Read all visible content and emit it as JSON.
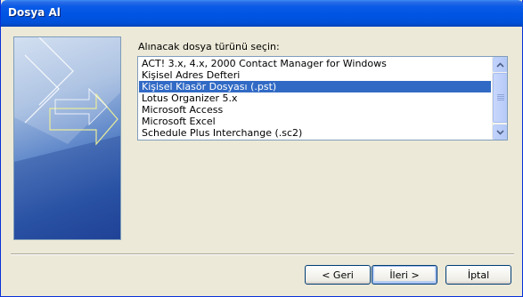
{
  "window": {
    "title": "Dosya Al"
  },
  "prompt": "Alınacak dosya türünü seçin:",
  "file_types": [
    "ACT! 3.x, 4.x, 2000 Contact Manager for Windows",
    "Kişisel Adres Defteri",
    "Kişisel Klasör Dosyası (.pst)",
    "Lotus Organizer 5.x",
    "Microsoft Access",
    "Microsoft Excel",
    "Schedule Plus Interchange (.sc2)"
  ],
  "selected_index": 2,
  "buttons": {
    "back": "< Geri",
    "next": "İleri >",
    "cancel": "İptal"
  },
  "colors": {
    "title_bar": "#0054E3",
    "selection": "#316AC5",
    "dialog_background": "#ECE9D8"
  }
}
